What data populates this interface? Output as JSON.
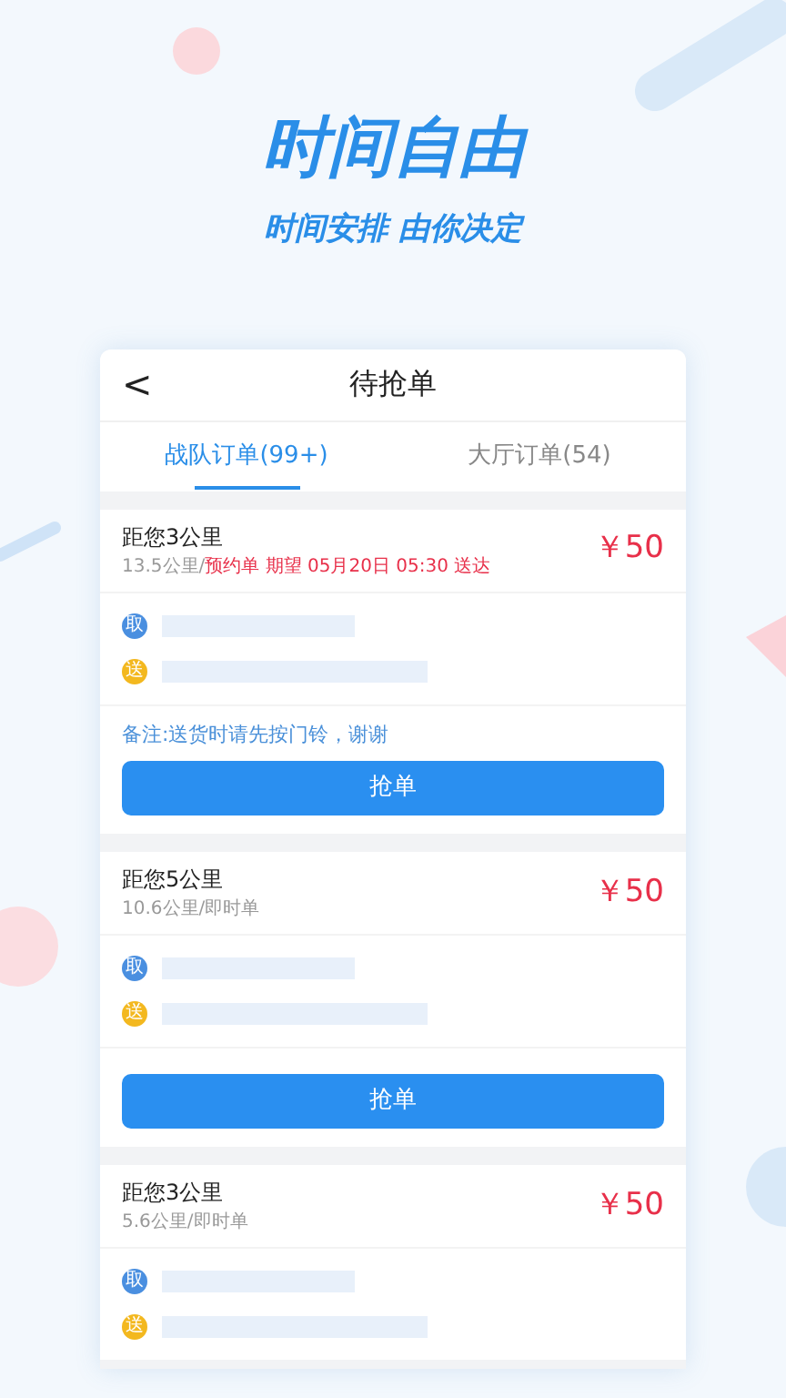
{
  "headline": "时间自由",
  "subheadline": "时间安排 由你决定",
  "nav": {
    "back": "<",
    "title": "待抢单"
  },
  "tabs": [
    {
      "label": "战队订单(99+)",
      "selected": true
    },
    {
      "label": "大厅订单(54)",
      "selected": false
    }
  ],
  "orders": [
    {
      "distance": "距您3公里",
      "detail": "13.5公里/",
      "detail_urgent": "预约单  期望 05月20日 05:30 送达",
      "price": "￥50",
      "pickup_mark": "取",
      "deliver_mark": "送",
      "note": "备注:送货时请先按门铃，谢谢",
      "button": "抢单"
    },
    {
      "distance": "距您5公里",
      "detail": "10.6公里/即时单",
      "price": "￥50",
      "pickup_mark": "取",
      "deliver_mark": "送",
      "button": "抢单"
    },
    {
      "distance": "距您3公里",
      "detail": "5.6公里/即时单",
      "price": "￥50",
      "pickup_mark": "取",
      "deliver_mark": "送"
    }
  ]
}
